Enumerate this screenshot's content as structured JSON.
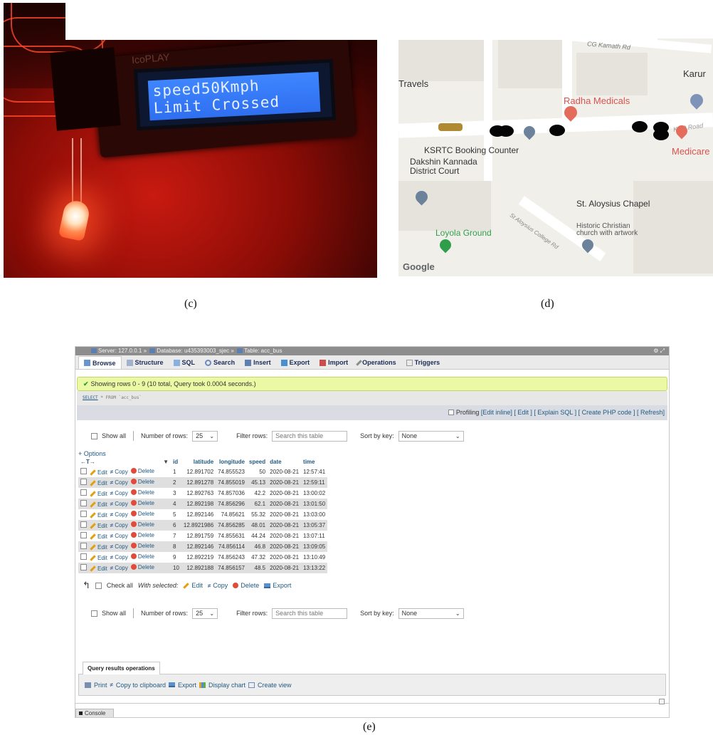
{
  "panels": {
    "c": {
      "caption": "(c)",
      "brand": "IcoPLAY",
      "lcd_line1": "speed50Kmph",
      "lcd_line2": "Limit Crossed"
    },
    "d": {
      "caption": "(d)",
      "labels": {
        "road_top": "CG Kamath Rd",
        "karur": "Karur",
        "travels": "Travels",
        "radha": "Radha Medicals",
        "road_right": "KRP Road",
        "medicare": "Medicare",
        "ksrtc": "KSRTC Booking Counter",
        "court1": "Dakshin Kannada",
        "court2": "District Court",
        "chapel": "St. Aloysius Chapel",
        "historic1": "Historic Christian",
        "historic2": "church with artwork",
        "road_diag": "St Aloysius College Rd",
        "loyola": "Loyola Ground",
        "google": "Google"
      },
      "colors": {
        "medical": "#d9534f",
        "park": "#2f9e4a",
        "place": "#5f7d9c"
      }
    },
    "e": {
      "caption": "(e)",
      "breadcrumb": {
        "server": "Server: 127.0.0.1",
        "database": "Database: u435393003_sjec",
        "table": "Table: acc_bus",
        "sep": "»"
      },
      "tabs": [
        "Browse",
        "Structure",
        "SQL",
        "Search",
        "Insert",
        "Export",
        "Import",
        "Operations",
        "Triggers"
      ],
      "success": "Showing rows 0 - 9 (10 total, Query took 0.0004 seconds.)",
      "sql": {
        "keyword": "SELECT",
        "rest": " * FROM `acc_bus`"
      },
      "profiling": "Profiling",
      "tool_links": "[Edit inline] [ Edit ] [ Explain SQL ] [ Create PHP code ] [ Refresh]",
      "nav": {
        "show_all": "Show all",
        "rows_label": "Number of rows:",
        "rows_value": "25",
        "filter_label": "Filter rows:",
        "filter_placeholder": "Search this table",
        "sort_label": "Sort by key:",
        "sort_value": "None"
      },
      "options": "+ Options",
      "table": {
        "arrows": "←T→",
        "headers": [
          "id",
          "latitude",
          "longitude",
          "speed",
          "date",
          "time"
        ],
        "actions": {
          "edit": "Edit",
          "copy": "Copy",
          "delete": "Delete"
        },
        "rows": [
          [
            "1",
            "12.891702",
            "74.855523",
            "50",
            "2020-08-21",
            "12:57:41"
          ],
          [
            "2",
            "12.891278",
            "74.855019",
            "45.13",
            "2020-08-21",
            "12:59:11"
          ],
          [
            "3",
            "12.892763",
            "74.857036",
            "42.2",
            "2020-08-21",
            "13:00:02"
          ],
          [
            "4",
            "12.892198",
            "74.856296",
            "62.1",
            "2020-08-21",
            "13:01:50"
          ],
          [
            "5",
            "12.892146",
            "74.85621",
            "55.32",
            "2020-08-21",
            "13:03:00"
          ],
          [
            "6",
            "12.8921986",
            "74.856285",
            "48.01",
            "2020-08-21",
            "13:05:37"
          ],
          [
            "7",
            "12.891759",
            "74.855631",
            "44.24",
            "2020-08-21",
            "13:07:11"
          ],
          [
            "8",
            "12.892146",
            "74.856114",
            "46.8",
            "2020-08-21",
            "13:09:05"
          ],
          [
            "9",
            "12.892219",
            "74.856243",
            "47.32",
            "2020-08-21",
            "13:10:49"
          ],
          [
            "10",
            "12.892188",
            "74.856157",
            "48.5",
            "2020-08-21",
            "13:13:22"
          ]
        ]
      },
      "bulk": {
        "check_all": "Check all",
        "with_selected": "With selected:",
        "edit": "Edit",
        "copy": "Copy",
        "delete": "Delete",
        "export": "Export"
      },
      "qro": {
        "title": "Query results operations",
        "print": "Print",
        "copy": "Copy to clipboard",
        "export": "Export",
        "chart": "Display chart",
        "view": "Create view"
      },
      "console": "Console"
    }
  }
}
